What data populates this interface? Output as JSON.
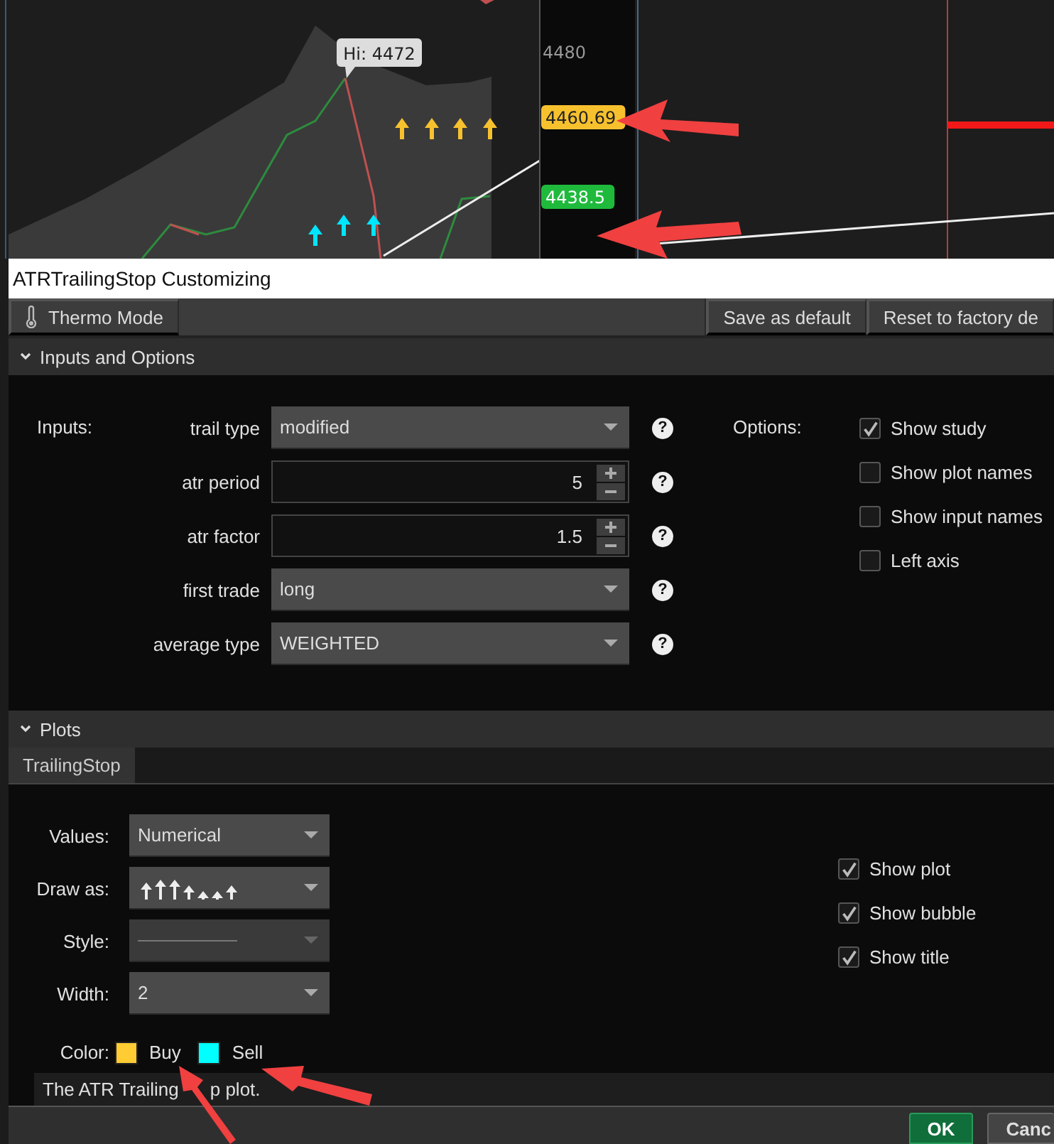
{
  "chart": {
    "high_label": "Hi: 4472",
    "axis_labels": [
      "4480"
    ],
    "price_bubbles": [
      {
        "text": "4460.69",
        "color": "#f7c12e"
      },
      {
        "text": "4438.5",
        "color": "#1fba3c"
      }
    ]
  },
  "dialog": {
    "title": "ATRTrailingStop Customizing",
    "toolbar": {
      "left": [
        {
          "label": "Thermo Mode"
        }
      ],
      "right": [
        {
          "label": "Save as default"
        },
        {
          "label": "Reset to factory de"
        }
      ]
    },
    "inputs_section": {
      "title": "Inputs and Options",
      "expanded": true,
      "inputs_label": "Inputs:",
      "inputs": [
        {
          "kind": "dropdown",
          "label": "trail type",
          "value": "modified",
          "help": "?"
        },
        {
          "kind": "spinner",
          "label": "atr period",
          "value": "5",
          "help": "?"
        },
        {
          "kind": "spinner",
          "label": "atr factor",
          "value": "1.5",
          "help": "?"
        },
        {
          "kind": "dropdown",
          "label": "first trade",
          "value": "long",
          "help": "?"
        },
        {
          "kind": "dropdown",
          "label": "average type",
          "value": "WEIGHTED",
          "help": "?"
        }
      ],
      "options_label": "Options:",
      "options": [
        {
          "label": "Show study",
          "checked": true
        },
        {
          "label": "Show plot names",
          "checked": false
        },
        {
          "label": "Show input names",
          "checked": false
        },
        {
          "label": "Left axis",
          "checked": false
        }
      ]
    },
    "plots_section": {
      "title": "Plots",
      "expanded": true,
      "tabs": [
        {
          "label": "TrailingStop",
          "selected": true
        }
      ],
      "fields": [
        {
          "kind": "text",
          "label": "Values:",
          "value": "Numerical",
          "disabled": false
        },
        {
          "kind": "arrows",
          "label": "Draw as:",
          "disabled": false
        },
        {
          "kind": "line",
          "label": "Style:",
          "disabled": true
        },
        {
          "kind": "text",
          "label": "Width:",
          "value": "2",
          "disabled": false
        }
      ],
      "color_label": "Color:",
      "colors": [
        {
          "label": "Buy",
          "color": "#ffcc33"
        },
        {
          "label": "Sell",
          "color": "#00ffff"
        }
      ],
      "options": [
        {
          "label": "Show plot",
          "checked": true
        },
        {
          "label": "Show bubble",
          "checked": true
        },
        {
          "label": "Show title",
          "checked": true
        }
      ],
      "description_parts": [
        "The ATR Trailing",
        "p plot."
      ]
    },
    "buttons": [
      {
        "kind": "primary",
        "label": "OK"
      },
      {
        "kind": "secondary",
        "label": "Canc"
      }
    ]
  }
}
